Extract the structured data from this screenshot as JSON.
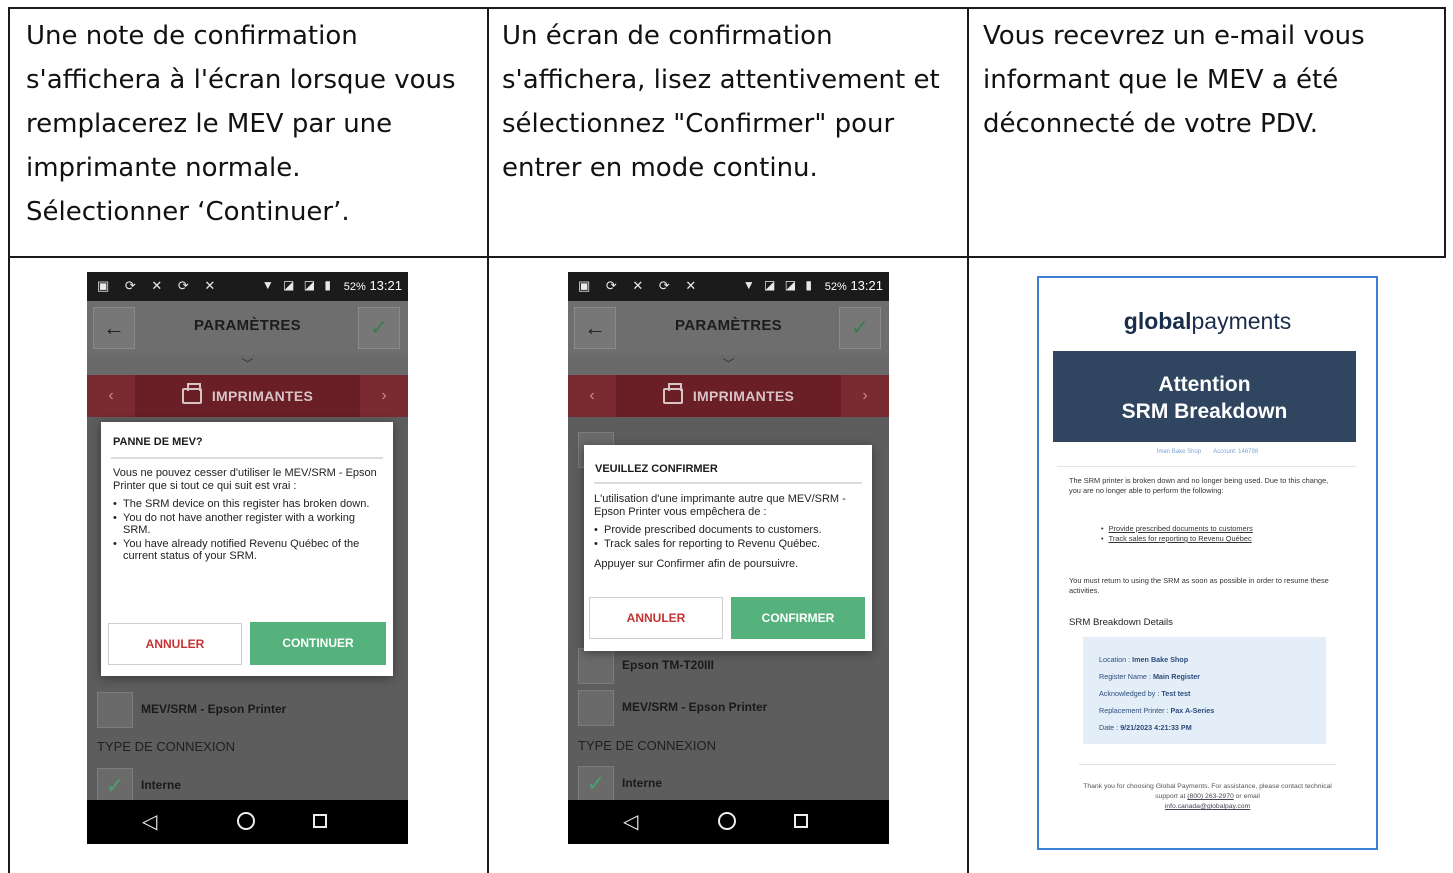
{
  "columns": [
    {
      "instruction": "Une note de confirmation\ns'affichera à l'écran lorsque vous\nremplacerez le MEV par une\nimprimante normale.\nSélectionner ‘Continuer’."
    },
    {
      "instruction": "Un écran de confirmation\ns'affichera, lisez attentivement et\nsélectionnez \"Confirmer\"  pour\nentrer en mode continu."
    },
    {
      "instruction": "Vous recevrez un e-mail vous\ninformant que le MEV a été\ndéconnecté de votre PDV."
    }
  ],
  "phone": {
    "status_time": "13:21",
    "status_battery": "52%",
    "appbar_title": "PARAMÈTRES",
    "category": "IMPRIMANTES",
    "printer_option_1": "Epson TM-T20III",
    "printer_option_2": "MEV/SRM - Epson Printer",
    "connection_section": "TYPE DE CONNEXION",
    "connection_option": "Interne"
  },
  "dialog1": {
    "title": "PANNE DE MEV?",
    "intro": "Vous ne pouvez cesser d'utiliser le MEV/SRM - Epson Printer que si tout ce qui suit est vrai :",
    "bullets": [
      "The SRM device on this register has broken down.",
      "You do not have another register with a working SRM.",
      "You have already notified Revenu Québec of the current status of your SRM."
    ],
    "cancel": "ANNULER",
    "confirm": "CONTINUER"
  },
  "dialog2": {
    "title": "VEUILLEZ CONFIRMER",
    "intro": "L'utilisation d'une imprimante autre que MEV/SRM - Epson Printer vous empêchera de :",
    "bullets": [
      "Provide prescribed documents to customers.",
      "Track sales for reporting to Revenu Québec."
    ],
    "outro": "Appuyer sur Confirmer afin de poursuivre.",
    "cancel": "ANNULER",
    "confirm": "CONFIRMER"
  },
  "email": {
    "logo_bold": "global",
    "logo_light": "payments",
    "banner_line1": "Attention",
    "banner_line2": "SRM Breakdown",
    "shop": "Imen Bake Shop",
    "account": "Account: 146798",
    "intro": "The SRM printer is broken down and no longer being used. Due to this change, you are no longer able to perform the following:",
    "list": [
      "Provide prescribed documents to customers",
      "Track sales for reporting to Revenu Québec"
    ],
    "return_note": "You must return to using the SRM as soon as possible in order to resume these activities.",
    "details_title": "SRM Breakdown Details",
    "details": {
      "location_label": "Location : ",
      "location": "Imen Bake Shop",
      "register_label": "Register Name : ",
      "register": "Main Register",
      "ack_label": "Acknowledged by : ",
      "ack": "Test test",
      "replacement_label": "Replacement Printer : ",
      "replacement": "Pax A-Series",
      "date_label": "Date : ",
      "date": "9/21/2023 4:21:33 PM"
    },
    "footer_text": "Thank you for choosing Global Payments. For assistance, please contact technical support at",
    "footer_phone": "(800) 263-2970",
    "footer_or": "or email",
    "footer_email": "info.canada@globalpay.com"
  },
  "colors": {
    "dialog_confirm": "#55b27c",
    "dialog_cancel_text": "#c43333",
    "category_bar": "#6a1e26",
    "email_banner": "#2f4560",
    "email_border": "#3b7fd6"
  }
}
